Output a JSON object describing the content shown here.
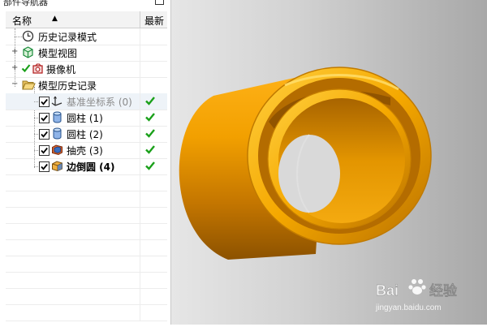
{
  "navigator": {
    "title": "部件导航器",
    "columns": {
      "name": "名称",
      "latest": "最新"
    },
    "items": [
      {
        "label": "历史记录模式"
      },
      {
        "label": "模型视图"
      },
      {
        "label": "摄像机"
      },
      {
        "label": "模型历史记录"
      },
      {
        "label": "基准坐标系 (0)"
      },
      {
        "label": "圆柱 (1)"
      },
      {
        "label": "圆柱 (2)"
      },
      {
        "label": "抽壳 (3)"
      },
      {
        "label": "边倒圆 (4)"
      }
    ]
  },
  "viewport": {
    "model": "hollow cylinder with shell and edge blend",
    "color": "#f0a000",
    "watermark": {
      "brand": "Bai",
      "brand2": "经验",
      "url": "jingyan.baidu.com"
    }
  },
  "colors": {
    "check": "#1aa01a",
    "accent": "#f0a000"
  }
}
